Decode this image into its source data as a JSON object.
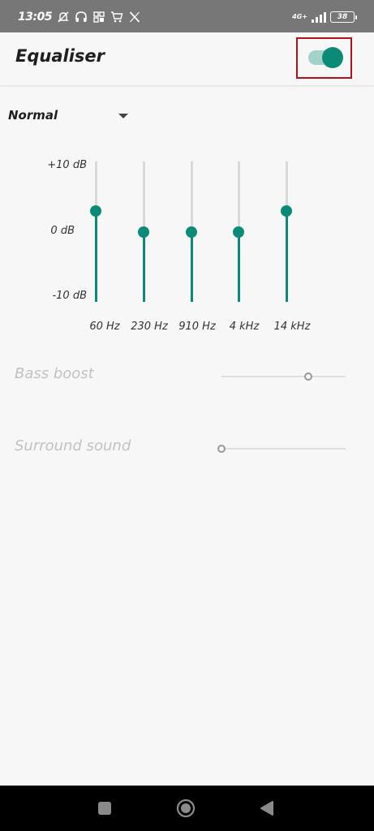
{
  "status_bar": {
    "time": "13:05",
    "network": "4G+",
    "battery": "38",
    "icons": [
      "mute-icon",
      "headphones-icon",
      "apps-icon",
      "shopping-cart-icon",
      "x-logo-icon",
      "signal-icon",
      "battery-icon"
    ]
  },
  "app_bar": {
    "title": "Equaliser",
    "toggle_on": true
  },
  "preset": {
    "selected": "Normal"
  },
  "equalizer": {
    "db_labels": [
      "+10 dB",
      "0 dB",
      "-10 dB"
    ],
    "range_db": [
      -10,
      10
    ],
    "bands": [
      {
        "label": "60 Hz",
        "level_db": 3
      },
      {
        "label": "230 Hz",
        "level_db": 0
      },
      {
        "label": "910 Hz",
        "level_db": 0
      },
      {
        "label": "4 kHz",
        "level_db": 0
      },
      {
        "label": "14 kHz",
        "level_db": 3
      }
    ]
  },
  "effects": [
    {
      "label": "Bass boost",
      "level": 0.7,
      "enabled": false
    },
    {
      "label": "Surround sound",
      "level": 0.0,
      "enabled": false
    }
  ],
  "colors": {
    "accent": "#0c8a78",
    "accent_light": "#a3d2cb",
    "highlight": "#b3111b"
  },
  "nav": {
    "icons": [
      "recents-icon",
      "home-icon",
      "back-icon"
    ]
  }
}
